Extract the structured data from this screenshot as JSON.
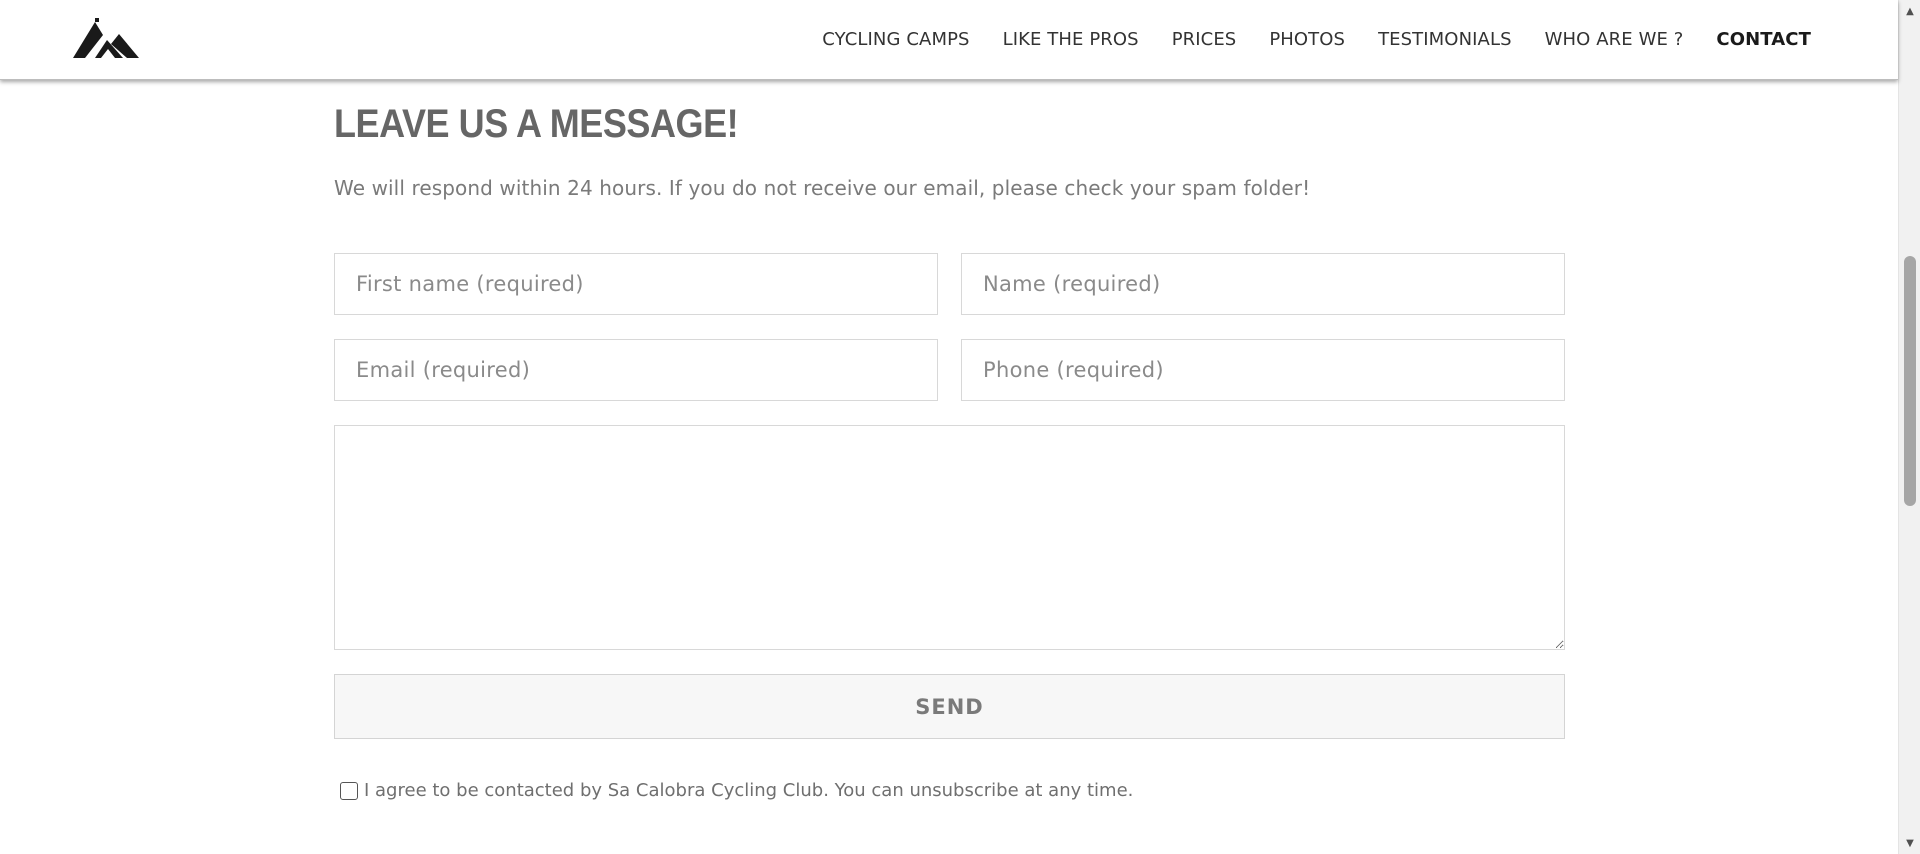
{
  "header": {
    "logo_icon": "mountain-logo-icon",
    "nav": [
      {
        "label": "CYCLING CAMPS"
      },
      {
        "label": "LIKE THE PROS"
      },
      {
        "label": "PRICES"
      },
      {
        "label": "PHOTOS"
      },
      {
        "label": "TESTIMONIALS"
      },
      {
        "label": "WHO ARE WE ?"
      },
      {
        "label": "CONTACT",
        "active": true
      }
    ]
  },
  "form": {
    "title": "LEAVE US A MESSAGE!",
    "subtitle": "We will respond within 24 hours. If you do not receive our email, please check your spam folder!",
    "first_name_placeholder": "First name (required)",
    "name_placeholder": "Name (required)",
    "email_placeholder": "Email (required)",
    "phone_placeholder": "Phone (required)",
    "message_value": "",
    "send_label": "SEND",
    "consent_label": "I agree to be contacted by Sa Calobra Cycling Club. You can unsubscribe at any time.",
    "consent_checked": false
  },
  "scrollbar": {
    "up_icon": "scroll-up-arrow-icon",
    "down_icon": "scroll-down-arrow-icon"
  }
}
